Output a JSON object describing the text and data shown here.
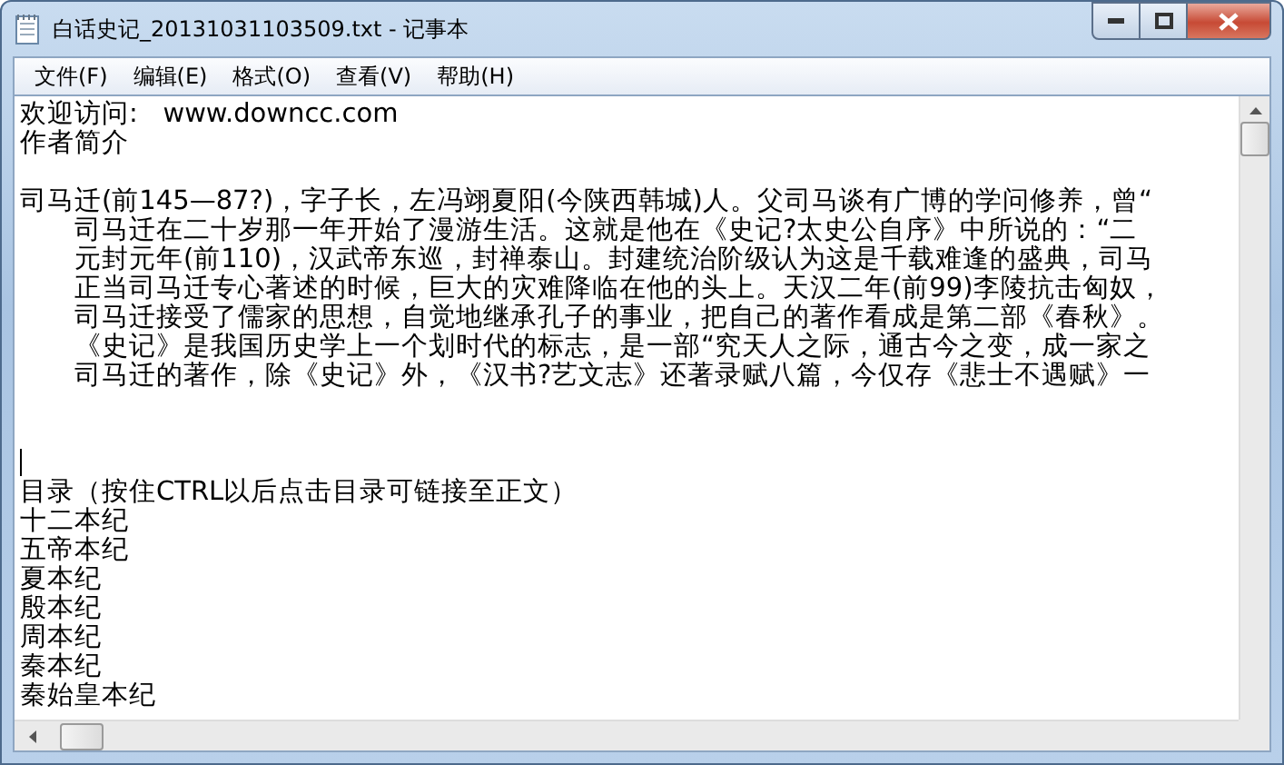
{
  "window": {
    "title": "白话史记_20131031103509.txt - 记事本"
  },
  "menu": [
    {
      "label": "文件(F)"
    },
    {
      "label": "编辑(E)"
    },
    {
      "label": "格式(O)"
    },
    {
      "label": "查看(V)"
    },
    {
      "label": "帮助(H)"
    }
  ],
  "document": {
    "lines": [
      {
        "kind": "text",
        "text": "欢迎访问:   www.downcc.com"
      },
      {
        "kind": "text",
        "text": "作者简介"
      },
      {
        "kind": "blank"
      },
      {
        "kind": "text",
        "text": "司马迁(前145—87?)，字子长，左冯翊夏阳(今陕西韩城)人。父司马谈有广博的学问修养，曾“"
      },
      {
        "kind": "indented",
        "text": "司马迁在二十岁那一年开始了漫游生活。这就是他在《史记?太史公自序》中所说的：“二"
      },
      {
        "kind": "indented",
        "text": "元封元年(前110)，汉武帝东巡，封禅泰山。封建统治阶级认为这是千载难逢的盛典，司马"
      },
      {
        "kind": "indented",
        "text": "正当司马迁专心著述的时候，巨大的灾难降临在他的头上。天汉二年(前99)李陵抗击匈奴，"
      },
      {
        "kind": "indented",
        "text": "司马迁接受了儒家的思想，自觉地继承孔子的事业，把自己的著作看成是第二部《春秋》。"
      },
      {
        "kind": "indented",
        "text": "《史记》是我国历史学上一个划时代的标志，是一部“究天人之际，通古今之变，成一家之"
      },
      {
        "kind": "indented",
        "text": "司马迁的著作，除《史记》外，《汉书?艺文志》还著录赋八篇，今仅存《悲士不遇赋》一"
      },
      {
        "kind": "blank"
      },
      {
        "kind": "blank"
      },
      {
        "kind": "cursor"
      },
      {
        "kind": "text",
        "text": "目录（按住CTRL以后点击目录可链接至正文）"
      },
      {
        "kind": "text",
        "text": "十二本纪"
      },
      {
        "kind": "text",
        "text": "五帝本纪"
      },
      {
        "kind": "text",
        "text": "夏本纪"
      },
      {
        "kind": "text",
        "text": "殷本纪"
      },
      {
        "kind": "text",
        "text": "周本纪"
      },
      {
        "kind": "text",
        "text": "秦本纪"
      },
      {
        "kind": "text",
        "text": "秦始皇本纪"
      }
    ]
  }
}
